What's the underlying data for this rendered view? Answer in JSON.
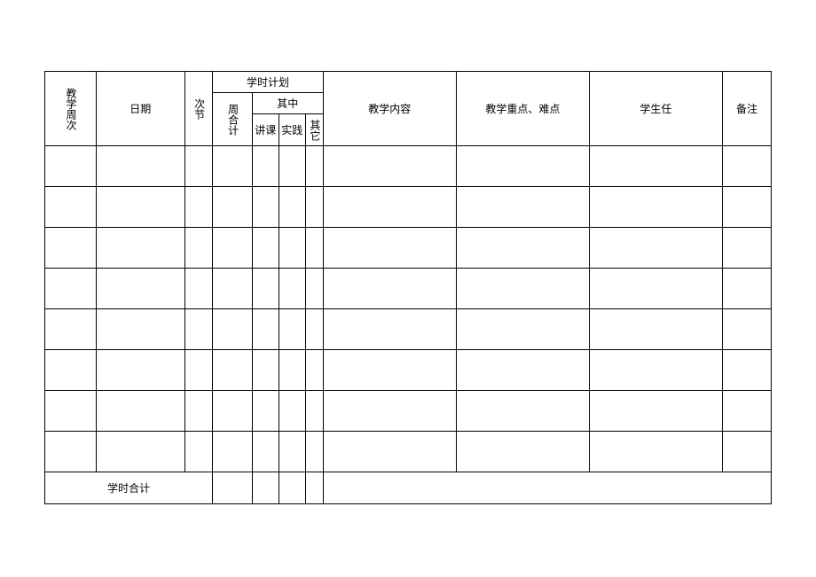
{
  "headers": {
    "teaching_week": "教学周次",
    "date": "日期",
    "session": "次节",
    "hour_plan": "学时计划",
    "week_total": "周合计",
    "among": "其中",
    "lecture": "讲课",
    "practice": "实践",
    "other": "其它",
    "content": "教学内容",
    "focus": "教学重点、难点",
    "student": "学生任",
    "remark": "备注"
  },
  "footer": {
    "hour_total": "学时合计"
  },
  "rows": [
    {
      "week": "",
      "date": "",
      "session": "",
      "wtotal": "",
      "lecture": "",
      "practice": "",
      "other": "",
      "content": "",
      "focus": "",
      "student": "",
      "remark": ""
    },
    {
      "week": "",
      "date": "",
      "session": "",
      "wtotal": "",
      "lecture": "",
      "practice": "",
      "other": "",
      "content": "",
      "focus": "",
      "student": "",
      "remark": ""
    },
    {
      "week": "",
      "date": "",
      "session": "",
      "wtotal": "",
      "lecture": "",
      "practice": "",
      "other": "",
      "content": "",
      "focus": "",
      "student": "",
      "remark": ""
    },
    {
      "week": "",
      "date": "",
      "session": "",
      "wtotal": "",
      "lecture": "",
      "practice": "",
      "other": "",
      "content": "",
      "focus": "",
      "student": "",
      "remark": ""
    },
    {
      "week": "",
      "date": "",
      "session": "",
      "wtotal": "",
      "lecture": "",
      "practice": "",
      "other": "",
      "content": "",
      "focus": "",
      "student": "",
      "remark": ""
    },
    {
      "week": "",
      "date": "",
      "session": "",
      "wtotal": "",
      "lecture": "",
      "practice": "",
      "other": "",
      "content": "",
      "focus": "",
      "student": "",
      "remark": ""
    },
    {
      "week": "",
      "date": "",
      "session": "",
      "wtotal": "",
      "lecture": "",
      "practice": "",
      "other": "",
      "content": "",
      "focus": "",
      "student": "",
      "remark": ""
    },
    {
      "week": "",
      "date": "",
      "session": "",
      "wtotal": "",
      "lecture": "",
      "practice": "",
      "other": "",
      "content": "",
      "focus": "",
      "student": "",
      "remark": ""
    }
  ]
}
